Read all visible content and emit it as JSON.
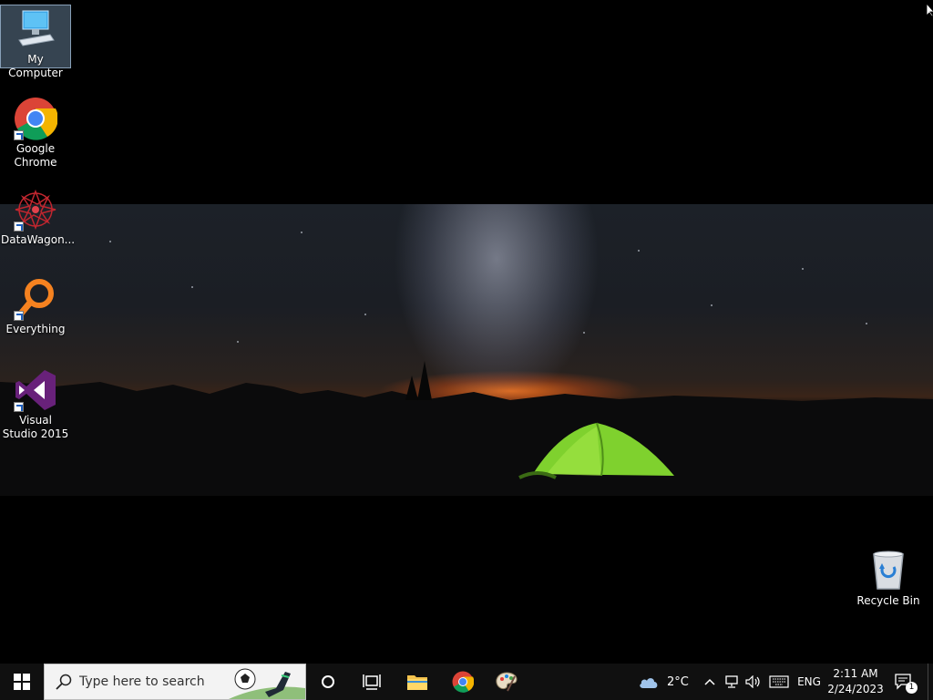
{
  "desktop": {
    "icons": [
      {
        "label": "My Computer",
        "icon": "computer-icon"
      },
      {
        "label": "Google Chrome",
        "icon": "chrome-icon"
      },
      {
        "label": "DataWagon...",
        "icon": "datawagon-icon"
      },
      {
        "label": "Everything",
        "icon": "everything-search-icon"
      },
      {
        "label": "Visual Studio 2015",
        "icon": "visual-studio-icon"
      },
      {
        "label": "Recycle Bin",
        "icon": "recycle-bin-icon"
      }
    ]
  },
  "taskbar": {
    "start_icon": "windows-logo-icon",
    "search_placeholder": "Type here to search",
    "pinned": [
      {
        "name": "cortana",
        "icon": "cortana-circle-icon"
      },
      {
        "name": "task-view",
        "icon": "task-view-icon"
      },
      {
        "name": "file-explorer",
        "icon": "folder-icon"
      },
      {
        "name": "chrome",
        "icon": "chrome-icon"
      },
      {
        "name": "paint",
        "icon": "paint-palette-icon"
      }
    ],
    "weather": {
      "temp": "2°C",
      "icon": "cloud-icon"
    },
    "tray": {
      "language": "ENG",
      "time": "2:11 AM",
      "date": "2/24/2023",
      "notifications_count": "1"
    }
  },
  "colors": {
    "taskbar_bg": "#101010",
    "desktop_bg": "#000000",
    "search_bg": "#f3f3f3",
    "tent_green": "#7fd12e",
    "horizon_orange": "#ff7a1e"
  }
}
